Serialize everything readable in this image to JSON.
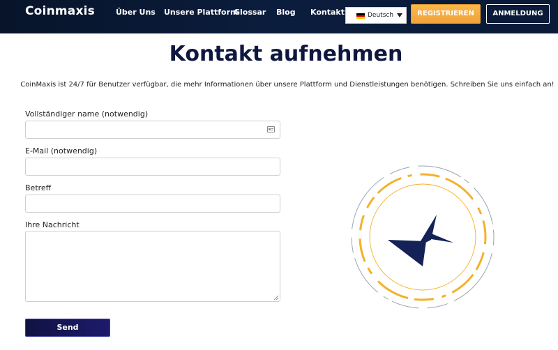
{
  "brand": {
    "logo_text": "Coinmaxis"
  },
  "nav": {
    "items": [
      "Über Uns",
      "Unsere Plattform",
      "Glossar",
      "Blog",
      "Kontakt"
    ]
  },
  "language": {
    "selected": "Deutsch",
    "flag": "german-flag-icon"
  },
  "header_buttons": {
    "register": "REGISTRIEREN",
    "login": "ANMELDUNG"
  },
  "page": {
    "title": "Kontakt aufnehmen",
    "intro": "CoinMaxis ist 24/7 für Benutzer verfügbar, die mehr Informationen über unsere Plattform und Dienstleistungen benötigen. Schreiben Sie uns einfach an!"
  },
  "form": {
    "name_label": "Vollständiger name (notwendig)",
    "email_label": "E-Mail (notwendig)",
    "subject_label": "Betreff",
    "message_label": "Ihre Nachricht",
    "name_value": "",
    "email_value": "",
    "subject_value": "",
    "message_value": "",
    "send_label": "Send"
  },
  "colors": {
    "header_bg": "#0b1d3d",
    "accent_orange": "#f3a23a",
    "button_dark": "#101243",
    "title_color": "#0f1740"
  }
}
